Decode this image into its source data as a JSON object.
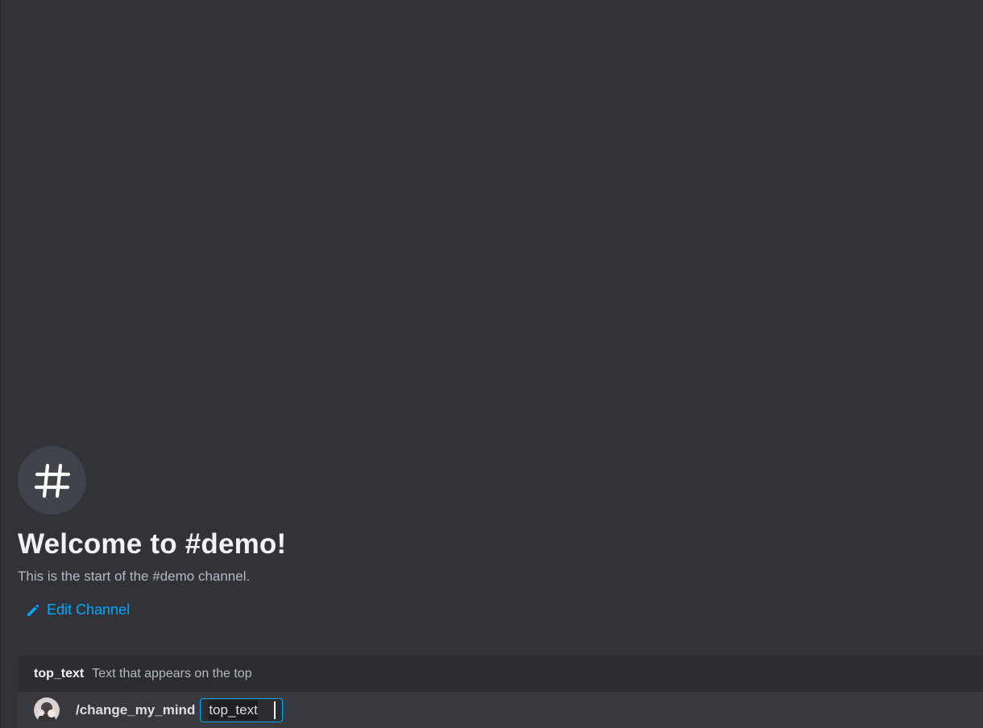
{
  "welcome": {
    "title": "Welcome to #demo!",
    "subtitle": "This is the start of the #demo channel.",
    "edit_label": "Edit Channel"
  },
  "option": {
    "name": "top_text",
    "description": "Text that appears on the top"
  },
  "composer": {
    "command": "/change_my_mind",
    "param_label": "top_text"
  },
  "colors": {
    "background": "#313338",
    "accent": "#00a8fc",
    "popup": "#2b2d31",
    "composer": "#383a40"
  },
  "icons": {
    "channel": "hash-icon",
    "edit": "pencil-icon",
    "avatar": "user-avatar"
  }
}
